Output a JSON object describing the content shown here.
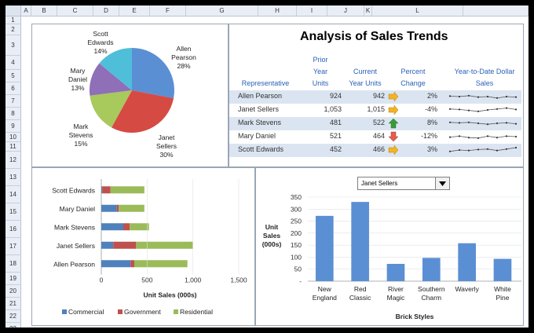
{
  "columns": [
    "A",
    "B",
    "C",
    "D",
    "E",
    "F",
    "G",
    "H",
    "I",
    "J",
    "K",
    "L"
  ],
  "rows": [
    "1",
    "2",
    "3",
    "4",
    "5",
    "6",
    "7",
    "8",
    "9",
    "10",
    "11",
    "12",
    "13",
    "14",
    "15",
    "16",
    "17",
    "18",
    "19",
    "20",
    "21",
    "22",
    "23"
  ],
  "title": "Analysis of Sales Trends",
  "table": {
    "headers": {
      "rep": "Representative",
      "prior": [
        "Prior",
        "Year",
        "Units"
      ],
      "current": [
        "Current",
        "Year Units"
      ],
      "pct": [
        "Percent",
        "Change"
      ],
      "ytd": [
        "Year-to-Date Dollar",
        "Sales"
      ]
    },
    "rows": [
      {
        "name": "Allen Pearson",
        "prior": "924",
        "current": "942",
        "pct": "2%",
        "trend": "flat",
        "spark": [
          0.55,
          0.5,
          0.6,
          0.45,
          0.5,
          0.35,
          0.5,
          0.45
        ]
      },
      {
        "name": "Janet Sellers",
        "prior": "1,053",
        "current": "1,015",
        "pct": "-4%",
        "trend": "flat",
        "spark": [
          0.6,
          0.55,
          0.45,
          0.35,
          0.5,
          0.6,
          0.7,
          0.55
        ]
      },
      {
        "name": "Mark Stevens",
        "prior": "481",
        "current": "522",
        "pct": "8%",
        "trend": "up",
        "spark": [
          0.6,
          0.55,
          0.6,
          0.5,
          0.4,
          0.5,
          0.55,
          0.45
        ]
      },
      {
        "name": "Mary Daniel",
        "prior": "521",
        "current": "464",
        "pct": "-12%",
        "trend": "down",
        "spark": [
          0.45,
          0.55,
          0.4,
          0.35,
          0.55,
          0.4,
          0.55,
          0.5
        ]
      },
      {
        "name": "Scott Edwards",
        "prior": "452",
        "current": "466",
        "pct": "3%",
        "trend": "flat",
        "spark": [
          0.35,
          0.5,
          0.45,
          0.55,
          0.6,
          0.45,
          0.6,
          0.75
        ]
      }
    ],
    "colors": {
      "up": "#3a9a3a",
      "down": "#e25c4c",
      "flat": "#f3b324",
      "header": "#2b62b8"
    }
  },
  "pie": {
    "chart_data": {
      "type": "pie",
      "labels": [
        "Allen Pearson",
        "Janet Sellers",
        "Mark Stevens",
        "Mary Daniel",
        "Scott Edwards"
      ],
      "values": [
        28,
        30,
        15,
        13,
        14
      ],
      "display": [
        [
          "Allen",
          "Pearson",
          "28%"
        ],
        [
          "Janet",
          "Sellers",
          "30%"
        ],
        [
          "Mark",
          "Stevens",
          "15%"
        ],
        [
          "Mary",
          "Daniel",
          "13%"
        ],
        [
          "Scott",
          "Edwards",
          "14%"
        ]
      ],
      "colors": [
        "#5b8fd4",
        "#d64a44",
        "#a8c95c",
        "#8e6fb8",
        "#4fbfd9"
      ]
    }
  },
  "stacked": {
    "chart_data": {
      "type": "bar",
      "orientation": "horizontal",
      "stacked": true,
      "categories": [
        "Scott Edwards",
        "Mary Daniel",
        "Mark Stevens",
        "Janet Sellers",
        "Allen Pearson"
      ],
      "series": [
        {
          "name": "Commercial",
          "values": [
            10,
            170,
            240,
            130,
            320
          ],
          "color": "#4f81bd"
        },
        {
          "name": "Government",
          "values": [
            90,
            20,
            70,
            250,
            40
          ],
          "color": "#c0504d"
        },
        {
          "name": "Residential",
          "values": [
            370,
            280,
            210,
            620,
            580
          ],
          "color": "#9bbb59"
        }
      ],
      "xlim": [
        0,
        1500
      ],
      "ticks": [
        "0",
        "500",
        "1,000",
        "1,500"
      ],
      "xlabel": "Unit Sales (000s)"
    }
  },
  "column": {
    "dropdown": "Janet Sellers",
    "chart_data": {
      "type": "bar",
      "categories": [
        [
          "New",
          "England"
        ],
        [
          "Red",
          "Classic"
        ],
        [
          "River",
          "Magic"
        ],
        [
          "Southern",
          "Charm"
        ],
        [
          "Waverly"
        ],
        [
          "White",
          "Pine"
        ]
      ],
      "values": [
        272,
        330,
        72,
        97,
        158,
        93
      ],
      "ylim": [
        0,
        350
      ],
      "ticks": [
        "-",
        "50",
        "100",
        "150",
        "200",
        "250",
        "300",
        "350"
      ],
      "ylabel": [
        "Unit",
        "Sales",
        "(000s)"
      ],
      "xlabel": "Brick Styles",
      "color": "#5b8fd4"
    }
  }
}
